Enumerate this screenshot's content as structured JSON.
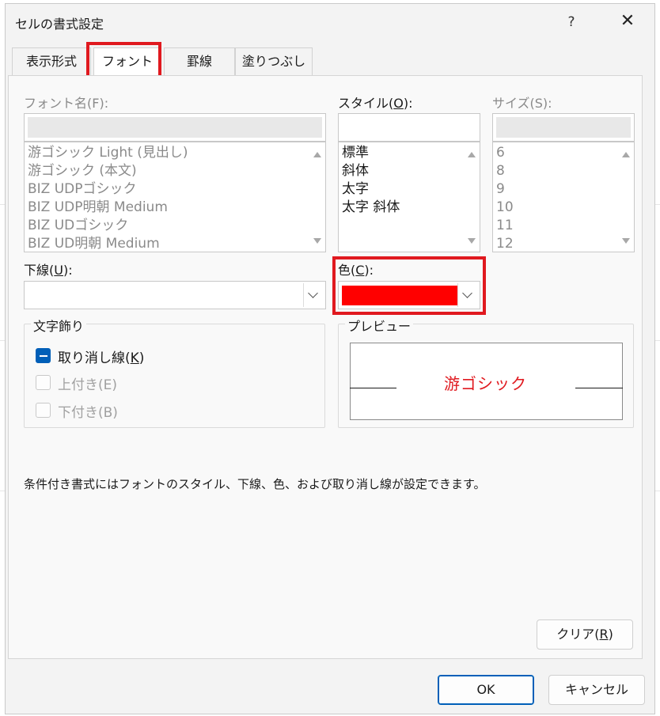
{
  "dialog": {
    "title": "セルの書式設定",
    "help": "?",
    "close": "✕"
  },
  "tabs": [
    {
      "label": "表示形式",
      "active": false
    },
    {
      "label": "フォント",
      "active": true
    },
    {
      "label": "罫線",
      "active": false
    },
    {
      "label": "塗りつぶし",
      "active": false
    }
  ],
  "font": {
    "label_prefix": "フォント名(F):",
    "value": "",
    "items": [
      "游ゴシック Light (見出し)",
      "游ゴシック (本文)",
      "BIZ UDPゴシック",
      "BIZ UDP明朝 Medium",
      "BIZ UDゴシック",
      "BIZ UD明朝 Medium"
    ]
  },
  "style": {
    "label_prefix": "スタイル(",
    "label_key": "O",
    "label_suffix": "):",
    "value": "",
    "items": [
      "標準",
      "斜体",
      "太字",
      "太字 斜体"
    ]
  },
  "size": {
    "label": "サイズ(S):",
    "value": "",
    "items": [
      "6",
      "8",
      "9",
      "10",
      "11",
      "12"
    ]
  },
  "underline": {
    "label_prefix": "下線(",
    "label_key": "U",
    "label_suffix": "):",
    "value": ""
  },
  "color": {
    "label_prefix": "色(",
    "label_key": "C",
    "label_suffix": "):",
    "value": "#ff0000"
  },
  "effects": {
    "title": "文字飾り",
    "strikethrough": {
      "label_prefix": "取り消し線(",
      "label_key": "K",
      "label_suffix": ")",
      "state": "indeterminate"
    },
    "superscript": {
      "label": "上付き(E)",
      "enabled": false
    },
    "subscript": {
      "label": "下付き(B)",
      "enabled": false
    }
  },
  "preview": {
    "title": "プレビュー",
    "sample_text": "游ゴシック",
    "text_color": "#e0191f"
  },
  "note": "条件付き書式にはフォントのスタイル、下線、色、および取り消し線が設定できます。",
  "buttons": {
    "clear_prefix": "クリア(",
    "clear_key": "R",
    "clear_suffix": ")",
    "ok": "OK",
    "cancel": "キャンセル"
  },
  "colors": {
    "accent": "#005fb8",
    "highlight": "#e0191f"
  }
}
